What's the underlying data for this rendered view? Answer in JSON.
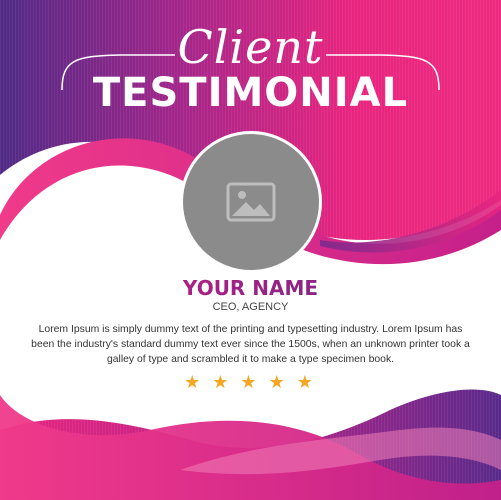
{
  "header": {
    "script_title": "Client",
    "main_title": "TESTIMONIAL"
  },
  "profile": {
    "photo_placeholder_icon": "image-icon",
    "name": "YOUR NAME",
    "role": "CEO, AGENCY"
  },
  "testimonial": {
    "text": "Lorem Ipsum is simply dummy text of the printing and typesetting industry. Lorem Ipsum has been the industry's standard dummy text ever since the 1500s, when an unknown printer took a galley of type and scrambled it to make a type specimen book."
  },
  "rating": {
    "stars": 5,
    "max": 5,
    "icon": "star-icon"
  },
  "colors": {
    "magenta": "#e8257f",
    "purple": "#6a2c8e",
    "photo_gray": "#8b8b8b",
    "star": "#f5a623"
  }
}
